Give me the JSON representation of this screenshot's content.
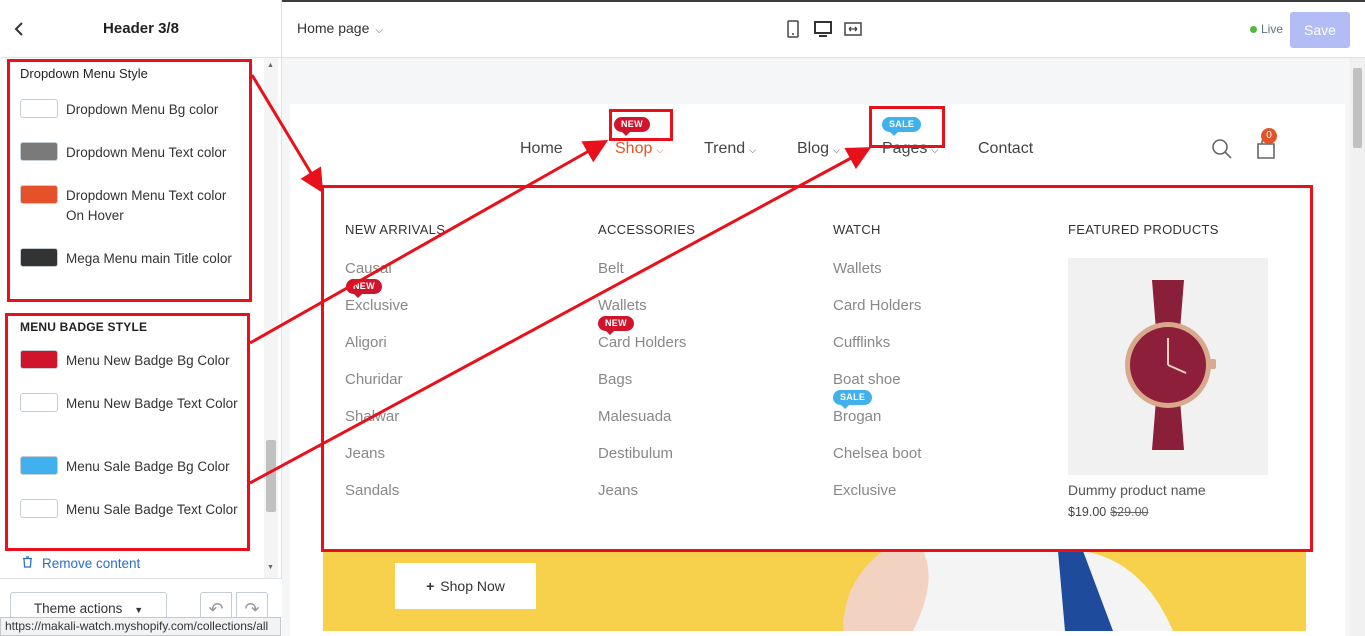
{
  "sidebar": {
    "title": "Header 3/8",
    "dropdown_section": {
      "title": "Dropdown Menu Style",
      "options": [
        {
          "label": "Dropdown Menu Bg color",
          "color": "#ffffff"
        },
        {
          "label": "Dropdown Menu Text color",
          "color": "#7a7a7a"
        },
        {
          "label": "Dropdown Menu Text color On Hover",
          "color": "#e5522a"
        },
        {
          "label": "Mega Menu main Title color",
          "color": "#333333"
        }
      ]
    },
    "badge_section": {
      "title": "MENU BADGE STYLE",
      "options": [
        {
          "label": "Menu New Badge Bg Color",
          "color": "#d0142c"
        },
        {
          "label": "Menu New Badge Text Color",
          "color": "#ffffff"
        },
        {
          "label": "Menu Sale Badge Bg Color",
          "color": "#40b1ec"
        },
        {
          "label": "Menu Sale Badge Text Color",
          "color": "#ffffff"
        }
      ]
    },
    "remove_label": "Remove content",
    "theme_actions_label": "Theme actions",
    "status_url": "https://makali-watch.myshopify.com/collections/all"
  },
  "topbar": {
    "page_label": "Home page",
    "live_label": "Live",
    "save_label": "Save"
  },
  "preview": {
    "nav": [
      "Home",
      "Shop",
      "Trend",
      "Blog",
      "Pages",
      "Contact"
    ],
    "badges": {
      "new": "NEW",
      "sale": "SALE"
    },
    "cart_count": "0",
    "columns": [
      {
        "title": "NEW ARRIVALS",
        "links": [
          "Causal",
          "Exclusive",
          "Aligori",
          "Churidar",
          "Shalwar",
          "Jeans",
          "Sandals"
        ]
      },
      {
        "title": "ACCESSORIES",
        "links": [
          "Belt",
          "Wallets",
          "Card Holders",
          "Bags",
          "Malesuada",
          "Destibulum",
          "Jeans"
        ]
      },
      {
        "title": "WATCH",
        "links": [
          "Wallets",
          "Card Holders",
          "Cufflinks",
          "Boat shoe",
          "Brogan",
          "Chelsea boot",
          "Exclusive"
        ]
      },
      {
        "title": "FEATURED PRODUCTS"
      }
    ],
    "featured": {
      "name": "Dummy product name",
      "price": "$19.00",
      "old_price": "$29.00"
    },
    "shop_now_label": "Shop Now"
  }
}
